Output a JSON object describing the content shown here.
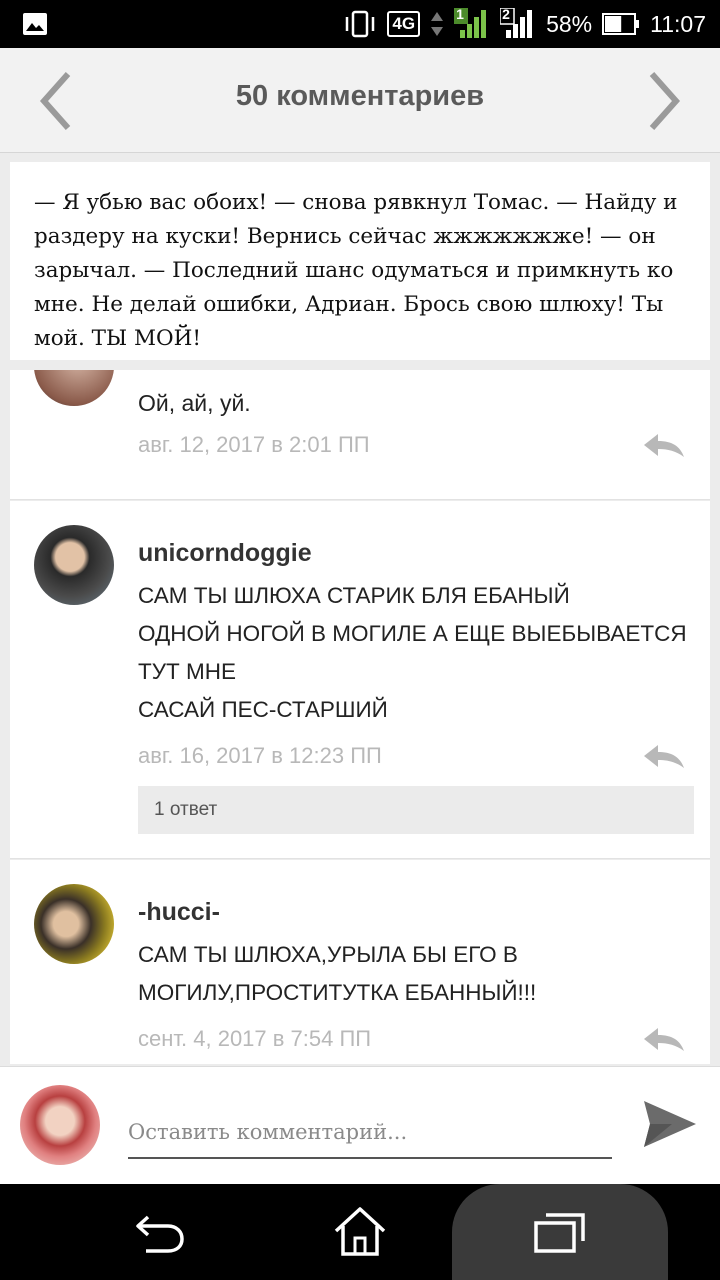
{
  "status_bar": {
    "network": "4G",
    "sim1": "1",
    "sim2": "2",
    "battery": "58%",
    "battery_level": 0.58,
    "time": "11:07",
    "icons": [
      "gallery-icon",
      "vibrate-icon",
      "data-arrows-icon",
      "signal-icon",
      "battery-icon"
    ]
  },
  "header": {
    "title": "50 комментариев",
    "prev_icon": "chevron-left-icon",
    "next_icon": "chevron-right-icon"
  },
  "quote": {
    "text": "— Я убью вас обоих! — снова рявкнул Томас. — Найду и раздеру на куски! Вернись сейчас жжжжжжже! — он зарычал. — Последний шанс одуматься и примкнуть ко мне. Не делай ошибки, Адриан. Брось свою шлюху! Ты мой. ТЫ МОЙ!"
  },
  "comments": [
    {
      "text": "Ой, ай, уй.",
      "date": "авг. 12, 2017 в 2:01 ПП"
    },
    {
      "user": "unicorndoggie",
      "text": "САМ ТЫ ШЛЮХА СТАРИК БЛЯ ЕБАНЫЙ\nОДНОЙ НОГОЙ В МОГИЛЕ А ЕЩЕ ВЫЕБЫВАЕТСЯ ТУТ МНЕ\nСАСАЙ ПЕС-СТАРШИЙ",
      "date": "авг. 16, 2017 в 12:23 ПП",
      "replies": "1 ответ"
    },
    {
      "user": "-hucci-",
      "text": "САМ ТЫ ШЛЮХА,УРЫЛА БЫ ЕГО В МОГИЛУ,ПРОСТИТУТКА ЕБАННЫЙ!!!",
      "date": "сент. 4, 2017 в 7:54 ПП"
    }
  ],
  "composer": {
    "placeholder": "Оставить комментарий..."
  },
  "colors": {
    "header_bg": "#f2f2f2",
    "title": "#5a5a5a",
    "date": "#b8b8b8",
    "replies_bg": "#ebebeb"
  }
}
